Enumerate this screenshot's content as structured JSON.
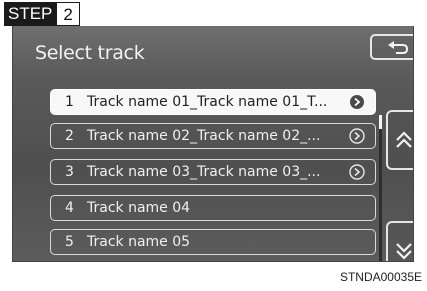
{
  "step": {
    "label": "STEP",
    "number": "2"
  },
  "screen": {
    "title": "Select track",
    "back_icon": "return-arrow-icon",
    "tracks": [
      {
        "number": "1",
        "name": "Track name 01_Track name 01_T...",
        "has_info": true,
        "selected": true
      },
      {
        "number": "2",
        "name": "Track name 02_Track name 02_...",
        "has_info": true,
        "selected": false
      },
      {
        "number": "3",
        "name": "Track name 03_Track name 03_...",
        "has_info": true,
        "selected": false
      },
      {
        "number": "4",
        "name": "Track name 04",
        "has_info": false,
        "selected": false
      },
      {
        "number": "5",
        "name": "Track name 05",
        "has_info": false,
        "selected": false
      }
    ],
    "scroll_up_icon": "double-chevron-up-icon",
    "scroll_down_icon": "double-chevron-down-icon"
  },
  "image_code": "STNDA00035E",
  "colors": {
    "screen_bg": "#5a5a5a",
    "border": "#d9d9d9",
    "selected_bg": "#f8f8f8"
  }
}
